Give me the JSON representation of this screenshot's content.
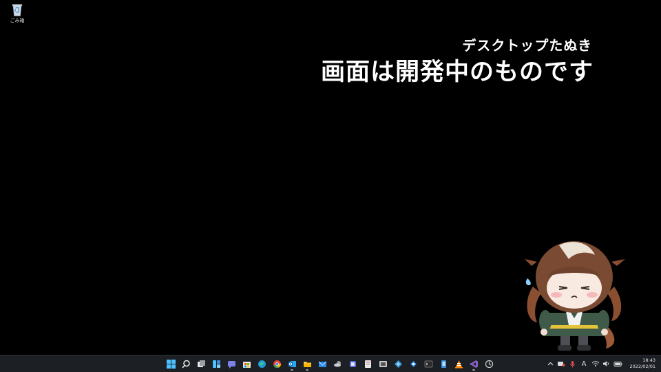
{
  "desktop": {
    "icons": [
      {
        "label": "ごみ箱",
        "icon": "recycle-bin-icon"
      }
    ]
  },
  "overlay": {
    "subtitle": "デスクトップたぬき",
    "title": "画面は開発中のものです"
  },
  "mascot": {
    "icon": "anime-girl-mascot"
  },
  "taskbar": {
    "pinned": [
      {
        "name": "start",
        "icon": "windows-start-icon"
      },
      {
        "name": "search",
        "icon": "search-icon"
      },
      {
        "name": "task-view",
        "icon": "task-view-icon"
      },
      {
        "name": "widgets",
        "icon": "widgets-icon"
      },
      {
        "name": "chat",
        "icon": "chat-icon"
      },
      {
        "name": "store",
        "icon": "store-icon"
      },
      {
        "name": "edge",
        "icon": "edge-icon"
      },
      {
        "name": "chrome",
        "icon": "chrome-icon"
      },
      {
        "name": "outlook",
        "icon": "outlook-icon"
      },
      {
        "name": "explorer",
        "icon": "folder-icon"
      },
      {
        "name": "mail",
        "icon": "mail-icon"
      },
      {
        "name": "weather",
        "icon": "weather-icon"
      },
      {
        "name": "app-a",
        "icon": "app-icon"
      },
      {
        "name": "app-b",
        "icon": "app-icon"
      },
      {
        "name": "app-c",
        "icon": "app-icon"
      },
      {
        "name": "app-d",
        "icon": "app-icon"
      },
      {
        "name": "app-e",
        "icon": "app-icon"
      },
      {
        "name": "terminal",
        "icon": "terminal-icon"
      },
      {
        "name": "app-f",
        "icon": "app-icon"
      },
      {
        "name": "vlc",
        "icon": "vlc-icon"
      },
      {
        "name": "visual-studio",
        "icon": "visual-studio-icon"
      },
      {
        "name": "app-g",
        "icon": "app-icon"
      }
    ],
    "tray": {
      "ime_label": "A",
      "clock_time": "18:43",
      "clock_date": "2022/02/01"
    }
  },
  "colors": {
    "background": "#000000",
    "taskbar": "#1c1f24",
    "accent": "#4cc2ff"
  }
}
